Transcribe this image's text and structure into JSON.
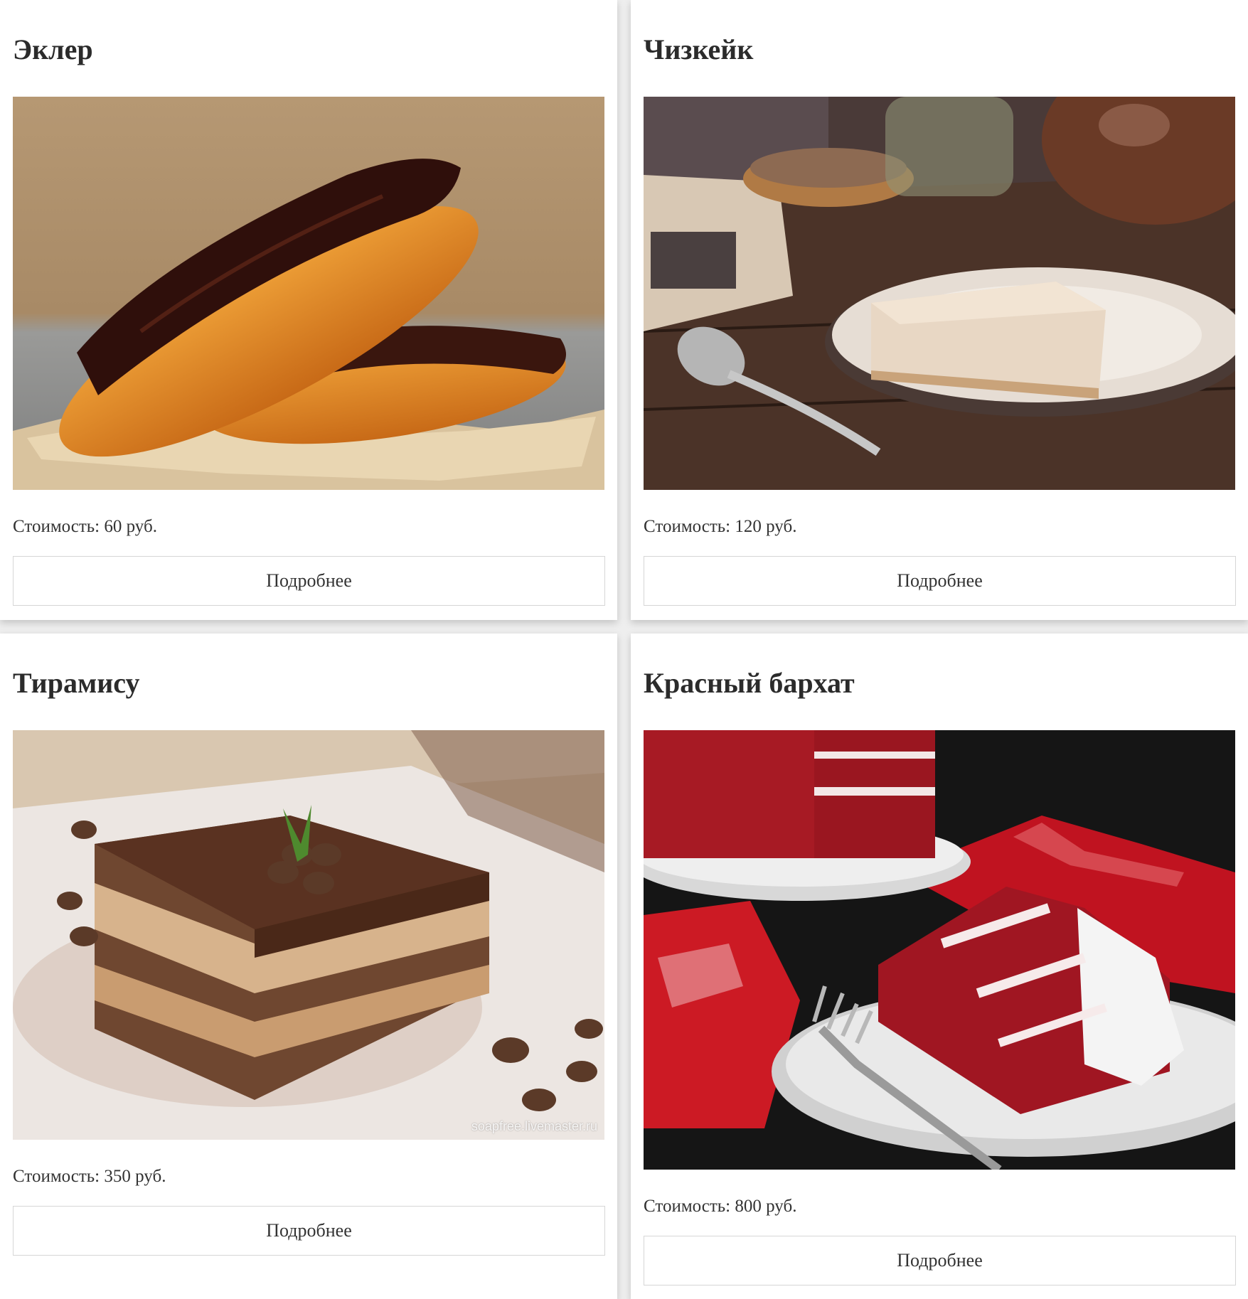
{
  "products": [
    {
      "title": "Эклер",
      "image": "eclair-photo",
      "price": "Стоимость: 60 руб.",
      "button": "Подробнее"
    },
    {
      "title": "Чизкейк",
      "image": "cheesecake-photo",
      "price": "Стоимость: 120 руб.",
      "button": "Подробнее"
    },
    {
      "title": "Тирамису",
      "image": "tiramisu-photo",
      "price": "Стоимость: 350 руб.",
      "button": "Подробнее",
      "watermark": "soapfree.livemaster.ru"
    },
    {
      "title": "Красный бархат",
      "image": "red-velvet-photo",
      "price": "Стоимость: 800 руб.",
      "button": "Подробнее"
    }
  ]
}
